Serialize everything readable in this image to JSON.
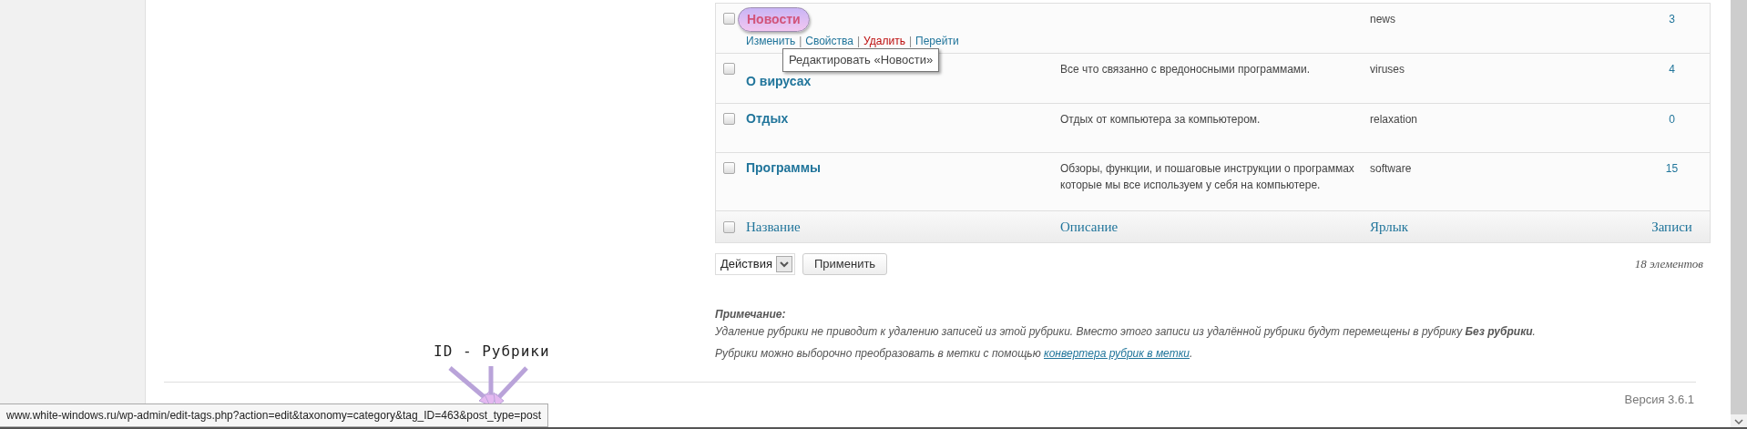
{
  "table": {
    "rows": [
      {
        "name": "Новости",
        "highlighted": true,
        "checked": false,
        "actions": [
          {
            "label": "Изменить",
            "kind": "normal"
          },
          {
            "label": "Свойства",
            "kind": "normal"
          },
          {
            "label": "Удалить",
            "kind": "delete"
          },
          {
            "label": "Перейти",
            "kind": "normal"
          }
        ],
        "slug": "news",
        "count": "3"
      },
      {
        "name": "О вирусах",
        "highlighted": false,
        "checked": false,
        "description": "Все что связанно с вредоносными программами.",
        "slug": "viruses",
        "count": "4"
      },
      {
        "name": "Отдых",
        "highlighted": false,
        "checked": false,
        "description": "Отдых от компьютера за компьютером.",
        "slug": "relaxation",
        "count": "0"
      },
      {
        "name": "Программы",
        "highlighted": false,
        "checked": false,
        "description": "Обзоры, функции, и пошаговые инструкции о программах которые мы все используем у себя на компьютере.",
        "slug": "software",
        "count": "15"
      }
    ],
    "action_separator": "|",
    "footer": {
      "checked": false,
      "columns": [
        "Название",
        "Описание",
        "Ярлык",
        "Записи"
      ]
    }
  },
  "tooltip": "Редактировать «Новости»",
  "bulk_actions": {
    "select": "Действия",
    "apply": "Применить",
    "count": "18 элементов"
  },
  "note": {
    "title": "Примечание:",
    "text": "Удаление рубрики не приводит к удалению записей из этой рубрики. Вместо этого записи из удалённой рубрики будут перемещены в рубрику **Без рубрики**.",
    "convert_before": "Рубрики можно выборочно преобразовать в метки с помощью",
    "convert_link": "конвертера рубрик в метки",
    "convert_after": "."
  },
  "version": "Версия 3.6.1",
  "annotation": "ID - Рубрики",
  "status_url": "www.white-windows.ru/wp-admin/edit-tags.php?action=edit&taxonomy=category&tag_ID=463&post_type=post"
}
